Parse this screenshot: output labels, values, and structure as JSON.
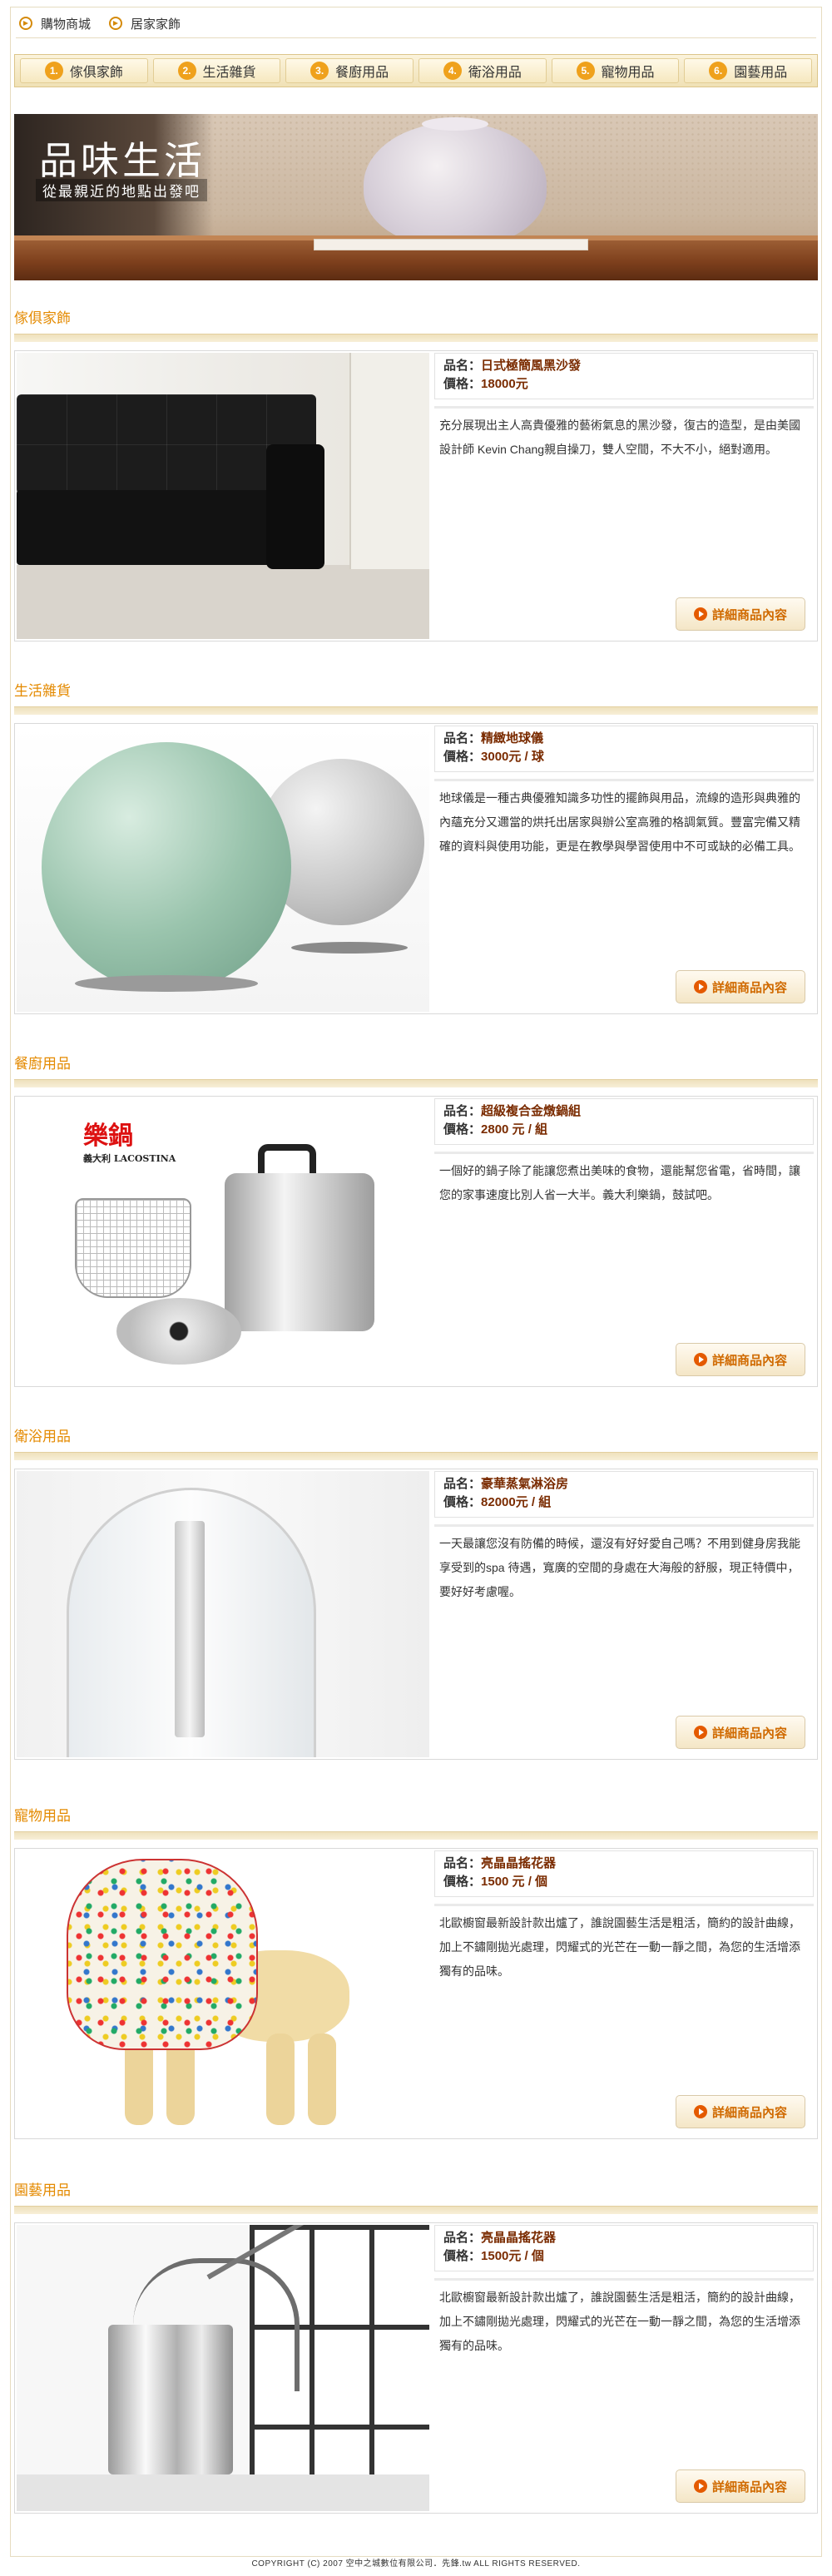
{
  "topnav": [
    {
      "label": "購物商城",
      "icon": "arrow-right-icon"
    },
    {
      "label": "居家家飾",
      "icon": "arrow-right-icon"
    }
  ],
  "tabs": [
    {
      "num": "1.",
      "label": "傢俱家飾"
    },
    {
      "num": "2.",
      "label": "生活雜貨"
    },
    {
      "num": "3.",
      "label": "餐廚用品"
    },
    {
      "num": "4.",
      "label": "衛浴用品"
    },
    {
      "num": "5.",
      "label": "寵物用品"
    },
    {
      "num": "6.",
      "label": "園藝用品"
    }
  ],
  "hero": {
    "title": "品味生活",
    "subtitle": "從最親近的地點出發吧"
  },
  "sections": [
    {
      "title": "傢俱家飾",
      "name_key": "品名：",
      "name": "日式極簡風黑沙發",
      "price_key": "價格：",
      "price": "18000元",
      "description": "充分展現出主人高貴優雅的藝術氣息的黑沙發，復古的造型，是由美國設計師 Kevin Chang親自操刀，雙人空間，不大不小，絕對適用。",
      "button": "詳細商品內容"
    },
    {
      "title": "生活雜貨",
      "name_key": "品名：",
      "name": "精緻地球儀",
      "price_key": "價格：",
      "price": "3000元 / 球",
      "description": "地球儀是一種古典優雅知識多功性的擺飾與用品，流線的造形與典雅的內蘊充分又邇當的烘托出居家與辦公室高雅的格調氣質。豐富完備又精確的資料與使用功能，更是在教學與學習使用中不可或缺的必備工具。",
      "button": "詳細商品內容"
    },
    {
      "title": "餐廚用品",
      "name_key": "品名：",
      "name": "超級複合金燉鍋組",
      "price_key": "價格：",
      "price": "2800 元 / 組",
      "description": "一個好的鍋子除了能讓您煮出美味的食物，還能幫您省電，省時間，讓您的家事速度比別人省一大半。義大利樂鍋，鼓試吧。",
      "button": "詳細商品內容",
      "brand": "樂鍋",
      "brand_sub": "義大利 LACOSTINA"
    },
    {
      "title": "衛浴用品",
      "name_key": "品名：",
      "name": "豪華蒸氣淋浴房",
      "price_key": "價格：",
      "price": "82000元 / 組",
      "description": "一天最讓您沒有防備的時候，還沒有好好愛自己嗎？不用到健身房我能享受到的spa 待遇，寬廣的空間的身處在大海般的舒服，現正特價中，要好好考慮喔。",
      "button": "詳細商品內容"
    },
    {
      "title": "寵物用品",
      "name_key": "品名：",
      "name": "亮晶晶搖花器",
      "price_key": "價格：",
      "price": "1500 元 / 個",
      "description": "北歐櫥窗最新設計款出爐了，誰說園藝生活是粗活，簡約的設計曲線，加上不鏽剛拋光處理，閃耀式的光芒在一動一靜之間，為您的生活增添獨有的品味。",
      "button": "詳細商品內容"
    },
    {
      "title": "園藝用品",
      "name_key": "品名：",
      "name": "亮晶晶搖花器",
      "price_key": "價格：",
      "price": "1500元 / 個",
      "description": "北歐櫥窗最新設計款出爐了，誰說園藝生活是粗活，簡約的設計曲線，加上不鏽剛拋光處理，閃耀式的光芒在一動一靜之間，為您的生活增添獨有的品味。",
      "button": "詳細商品內容"
    }
  ],
  "footer": "COPYRIGHT (C) 2007 空中之城數位有限公司．先鋒.tw ALL RIGHTS RESERVED."
}
